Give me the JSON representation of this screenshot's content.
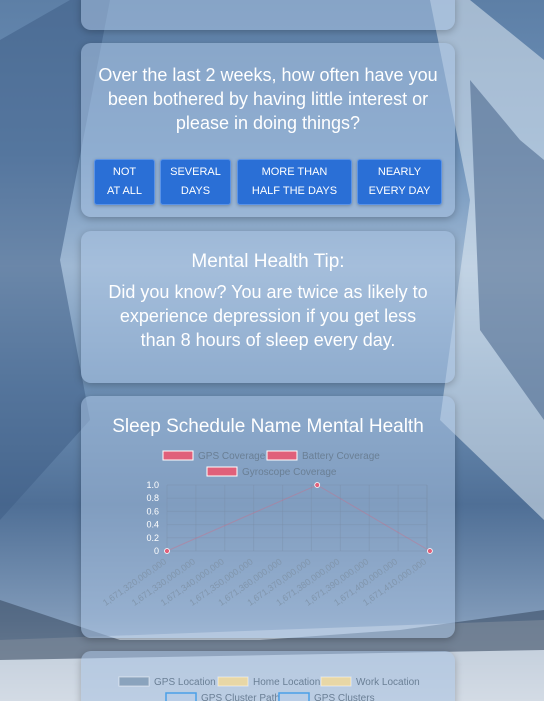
{
  "question": {
    "text": "Over the last 2 weeks, how often have you been bothered by having little interest or please in doing things?",
    "options": [
      "NOT\nAT ALL",
      "SEVERAL\nDAYS",
      "MORE THAN\nHALF THE DAYS",
      "NEARLY\nEVERY DAY"
    ]
  },
  "tip": {
    "title": "Mental Health Tip:",
    "body": "Did you know? You are twice as likely to experience depression if you get less than 8 hours of sleep every day."
  },
  "chart_data": {
    "type": "line",
    "title": "Sleep Schedule Name Mental Health",
    "legend": [
      "GPS Coverage",
      "Battery Coverage",
      "Gyroscope Coverage"
    ],
    "series_colors": [
      "#e0607a",
      "#e0607a",
      "#e0607a"
    ],
    "x_ticks": [
      "1,671,320,000,000",
      "1,671,330,000,000",
      "1,671,340,000,000",
      "1,671,350,000,000",
      "1,671,360,000,000",
      "1,671,370,000,000",
      "1,671,380,000,000",
      "1,671,390,000,000",
      "1,671,400,000,000",
      "1,671,410,000,000"
    ],
    "y_ticks": [
      "0",
      "0.2",
      "0.4",
      "0.6",
      "0.8",
      "1.0"
    ],
    "ylim": [
      0,
      1
    ],
    "xlim": [
      1671320000000,
      1671410000000
    ],
    "points": [
      {
        "x": 1671320000000,
        "y": 0
      },
      {
        "x": 1671372000000,
        "y": 1
      },
      {
        "x": 1671411000000,
        "y": 0
      }
    ]
  },
  "map_legend": {
    "items": [
      "GPS Location",
      "Home Location",
      "Work Location",
      "GPS Cluster Path",
      "GPS Clusters"
    ],
    "colors": [
      "#8aa3bd",
      "#e8d7a6",
      "#e8d7a6",
      "#4aa0e8",
      "#4aa0e8"
    ]
  }
}
